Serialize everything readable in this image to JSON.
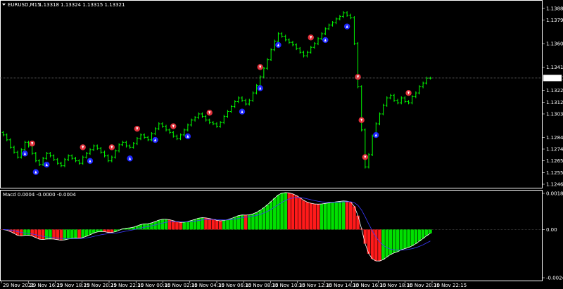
{
  "header": {
    "symbol": "EURUSD,M15",
    "ohlc": "1.13318 1.13324 1.13315 1.13321"
  },
  "macd_panel": {
    "title": "Macd 0.0004 -0.0000 -0.0004"
  },
  "colors": {
    "background": "#000000",
    "candle": "#00ff00",
    "sell_arrow": "#e0303a",
    "buy_arrow": "#1e28ff",
    "hist_up": "#00e000",
    "hist_down": "#ff1a1a",
    "macd_line": "#ffffff",
    "signal_line": "#3a3aff",
    "axis": "#ffffff",
    "grid": "#ffffff"
  },
  "icons": {
    "sell_signal": "red-down-arrow-circle-icon",
    "buy_signal": "blue-up-arrow-circle-icon",
    "header_dropdown": "triangle-down-icon"
  },
  "chart_data": [
    {
      "type": "candlestick",
      "title": "EURUSD,M15",
      "ylim": [
        1.1246,
        1.13885
      ],
      "current_price": 1.13321,
      "current_price_label": "1.13321",
      "y_ticks": [
        "1.13885",
        "1.13790",
        "1.13600",
        "1.13410",
        "1.13220",
        "1.13125",
        "1.13030",
        "1.12840",
        "1.12745",
        "1.12650",
        "1.12555",
        "1.12460"
      ],
      "y_tick_values": [
        1.13885,
        1.1379,
        1.136,
        1.1341,
        1.1322,
        1.13125,
        1.1303,
        1.1284,
        1.12745,
        1.1265,
        1.12555,
        1.1246
      ],
      "x_ticks": [
        "29 Nov 2021",
        "29 Nov 16:15",
        "29 Nov 18:15",
        "29 Nov 20:15",
        "29 Nov 22:15",
        "30 Nov 00:15",
        "30 Nov 02:15",
        "30 Nov 04:15",
        "30 Nov 06:15",
        "30 Nov 08:15",
        "30 Nov 10:15",
        "30 Nov 12:15",
        "30 Nov 14:15",
        "30 Nov 16:15",
        "30 Nov 18:15",
        "30 Nov 20:15",
        "30 Nov 22:15"
      ],
      "closes": [
        1.1286,
        1.1282,
        1.1276,
        1.1272,
        1.1268,
        1.1274,
        1.128,
        1.1277,
        1.1271,
        1.1265,
        1.1262,
        1.1267,
        1.1271,
        1.1269,
        1.1266,
        1.1263,
        1.1261,
        1.1266,
        1.1269,
        1.1267,
        1.1265,
        1.1263,
        1.1268,
        1.1271,
        1.1274,
        1.1277,
        1.1275,
        1.1272,
        1.1269,
        1.1265,
        1.1268,
        1.1273,
        1.1278,
        1.128,
        1.1277,
        1.1276,
        1.1279,
        1.1283,
        1.1286,
        1.1284,
        1.1282,
        1.1287,
        1.1291,
        1.1295,
        1.1293,
        1.129,
        1.1288,
        1.1285,
        1.1283,
        1.1286,
        1.129,
        1.1294,
        1.1298,
        1.13,
        1.1303,
        1.1301,
        1.1298,
        1.1296,
        1.1295,
        1.1293,
        1.1296,
        1.1301,
        1.1305,
        1.1309,
        1.1313,
        1.1316,
        1.1314,
        1.1311,
        1.1314,
        1.132,
        1.1326,
        1.1333,
        1.134,
        1.1347,
        1.1355,
        1.1362,
        1.1368,
        1.1366,
        1.1363,
        1.1361,
        1.1359,
        1.1356,
        1.1353,
        1.135,
        1.1353,
        1.1357,
        1.136,
        1.1364,
        1.1368,
        1.1372,
        1.1375,
        1.1377,
        1.138,
        1.1382,
        1.1385,
        1.1383,
        1.1381,
        1.136,
        1.1325,
        1.129,
        1.126,
        1.127,
        1.1285,
        1.1295,
        1.1303,
        1.131,
        1.1316,
        1.1318,
        1.1314,
        1.1312,
        1.1316,
        1.1313,
        1.1312,
        1.1317,
        1.132,
        1.1325,
        1.1328,
        1.1332,
        1.1332
      ],
      "sell_arrow_bars": [
        8,
        22,
        30,
        37,
        47,
        57,
        71,
        85,
        98,
        99,
        100,
        112
      ],
      "buy_arrow_bars": [
        6,
        9,
        12,
        24,
        35,
        42,
        51,
        66,
        71,
        76,
        89,
        95,
        103
      ]
    },
    {
      "type": "histogram",
      "title": "Macd",
      "ylim": [
        -0.0024,
        0.0018
      ],
      "y_ticks": [
        "0.0018",
        "0.00",
        "-0.0024"
      ],
      "y_tick_values": [
        0.0018,
        0.0,
        -0.0024
      ]
    }
  ]
}
